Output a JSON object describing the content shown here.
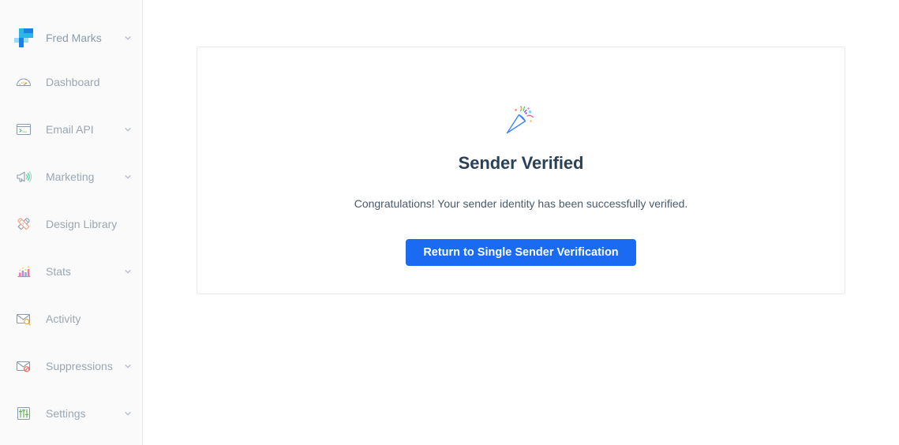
{
  "sidebar": {
    "brand": {
      "name": "Fred Marks",
      "logo_colors": [
        "#9bdcf5",
        "#29b6e8",
        "#1a82e2"
      ],
      "chevron_icon": "chevron-down-icon"
    },
    "items": [
      {
        "label": "Dashboard",
        "icon": "dashboard-gauge-icon",
        "has_chevron": false
      },
      {
        "label": "Email API",
        "icon": "terminal-window-icon",
        "has_chevron": true
      },
      {
        "label": "Marketing",
        "icon": "megaphone-icon",
        "has_chevron": true
      },
      {
        "label": "Design Library",
        "icon": "pencil-ruler-icon",
        "has_chevron": false
      },
      {
        "label": "Stats",
        "icon": "bar-chart-icon",
        "has_chevron": true
      },
      {
        "label": "Activity",
        "icon": "envelope-search-icon",
        "has_chevron": false
      },
      {
        "label": "Suppressions",
        "icon": "envelope-blocked-icon",
        "has_chevron": true
      },
      {
        "label": "Settings",
        "icon": "sliders-icon",
        "has_chevron": true
      }
    ]
  },
  "main": {
    "card": {
      "icon": "party-popper-icon",
      "title": "Sender Verified",
      "message": "Congratulations! Your sender identity has been successfully verified.",
      "button_label": "Return to Single Sender Verification"
    }
  },
  "colors": {
    "accent": "#1a6bf1",
    "sidebar_bg": "#fafafa",
    "main_bg": "#ffffff",
    "card_border": "#e6e8eb",
    "title_text": "#2a4158",
    "body_text": "#4a5b6d",
    "nav_text": "#9aa7b4"
  }
}
